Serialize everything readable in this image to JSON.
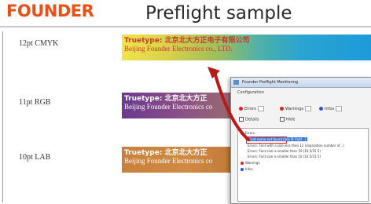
{
  "header": {
    "logo": "FOUNDER",
    "title": "Preflight sample"
  },
  "rows": [
    {
      "label": "12pt CMYK",
      "line1": "Truetype: 北京北大方正电子有限公司",
      "line2": "Beijing Founder Electronics co., LTD."
    },
    {
      "label": "11pt RGB",
      "line1": "Truetype: 北京北大方正",
      "line2": "Beijing Founder Electronics co"
    },
    {
      "label": "10pt LAB",
      "line1": "Truetype: 北京北大方正",
      "line2": "Beijing Founder Electronics co"
    }
  ],
  "dialog": {
    "title": "Founder Preflight Monitoring",
    "configuration": "Configuration",
    "levels": [
      "Errors",
      "Warnings",
      "Infos"
    ],
    "checks": [
      "Details",
      "Hide"
    ],
    "tree": [
      "Errors",
      "Font name not found (line 8: Font...)",
      "Errors: Font with a size less than 12 (separation number of...)",
      "Errors: Font size is smaller than 10 (10.5/31.5)",
      "Errors: Font size is smaller than 10 (10.5/31.5)",
      "Warnings",
      "Infos"
    ]
  },
  "colors": {
    "logo": "#e8501a",
    "error": "#d32424",
    "info": "#2a56c7",
    "arrow": "#b81a1a"
  }
}
